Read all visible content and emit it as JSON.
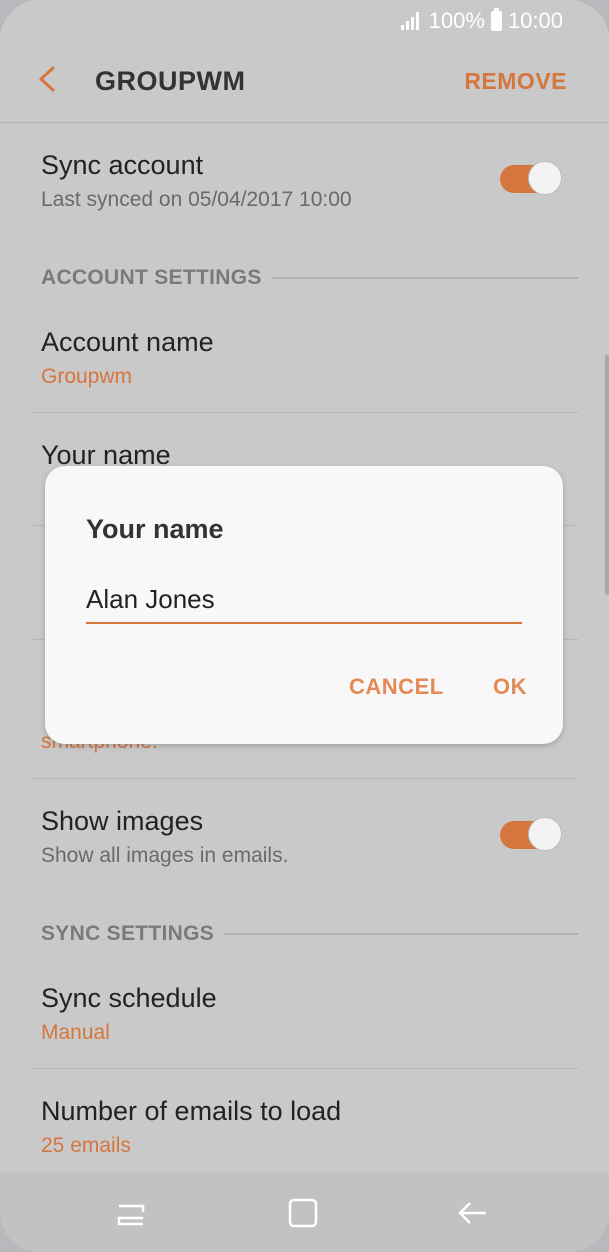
{
  "status": {
    "battery": "100%",
    "time": "10:00"
  },
  "appbar": {
    "title": "GROUPWM",
    "action": "REMOVE",
    "back_icon": "back-arrow-icon"
  },
  "sync_account": {
    "label": "Sync account",
    "sub": "Last synced on 05/04/2017  10:00",
    "enabled": true
  },
  "sections": {
    "account": "ACCOUNT SETTINGS",
    "sync": "SYNC SETTINGS"
  },
  "account_name": {
    "label": "Account name",
    "value": "Groupwm"
  },
  "your_name": {
    "label": "Your name"
  },
  "obscured": {
    "partial_value": "smartphone."
  },
  "show_images": {
    "label": "Show images",
    "sub": "Show all images in emails.",
    "enabled": true
  },
  "sync_schedule": {
    "label": "Sync schedule",
    "value": "Manual"
  },
  "emails_to_load": {
    "label": "Number of emails to load",
    "value": "25 emails"
  },
  "dialog": {
    "title": "Your name",
    "value": "Alan Jones",
    "cancel": "CANCEL",
    "ok": "OK"
  },
  "navbar": {
    "icons": [
      "recent-apps-icon",
      "home-icon",
      "back-icon"
    ]
  },
  "colors": {
    "accent": "#d5763f",
    "background": "#c9c9c9",
    "dialog": "#f8f8f8"
  }
}
